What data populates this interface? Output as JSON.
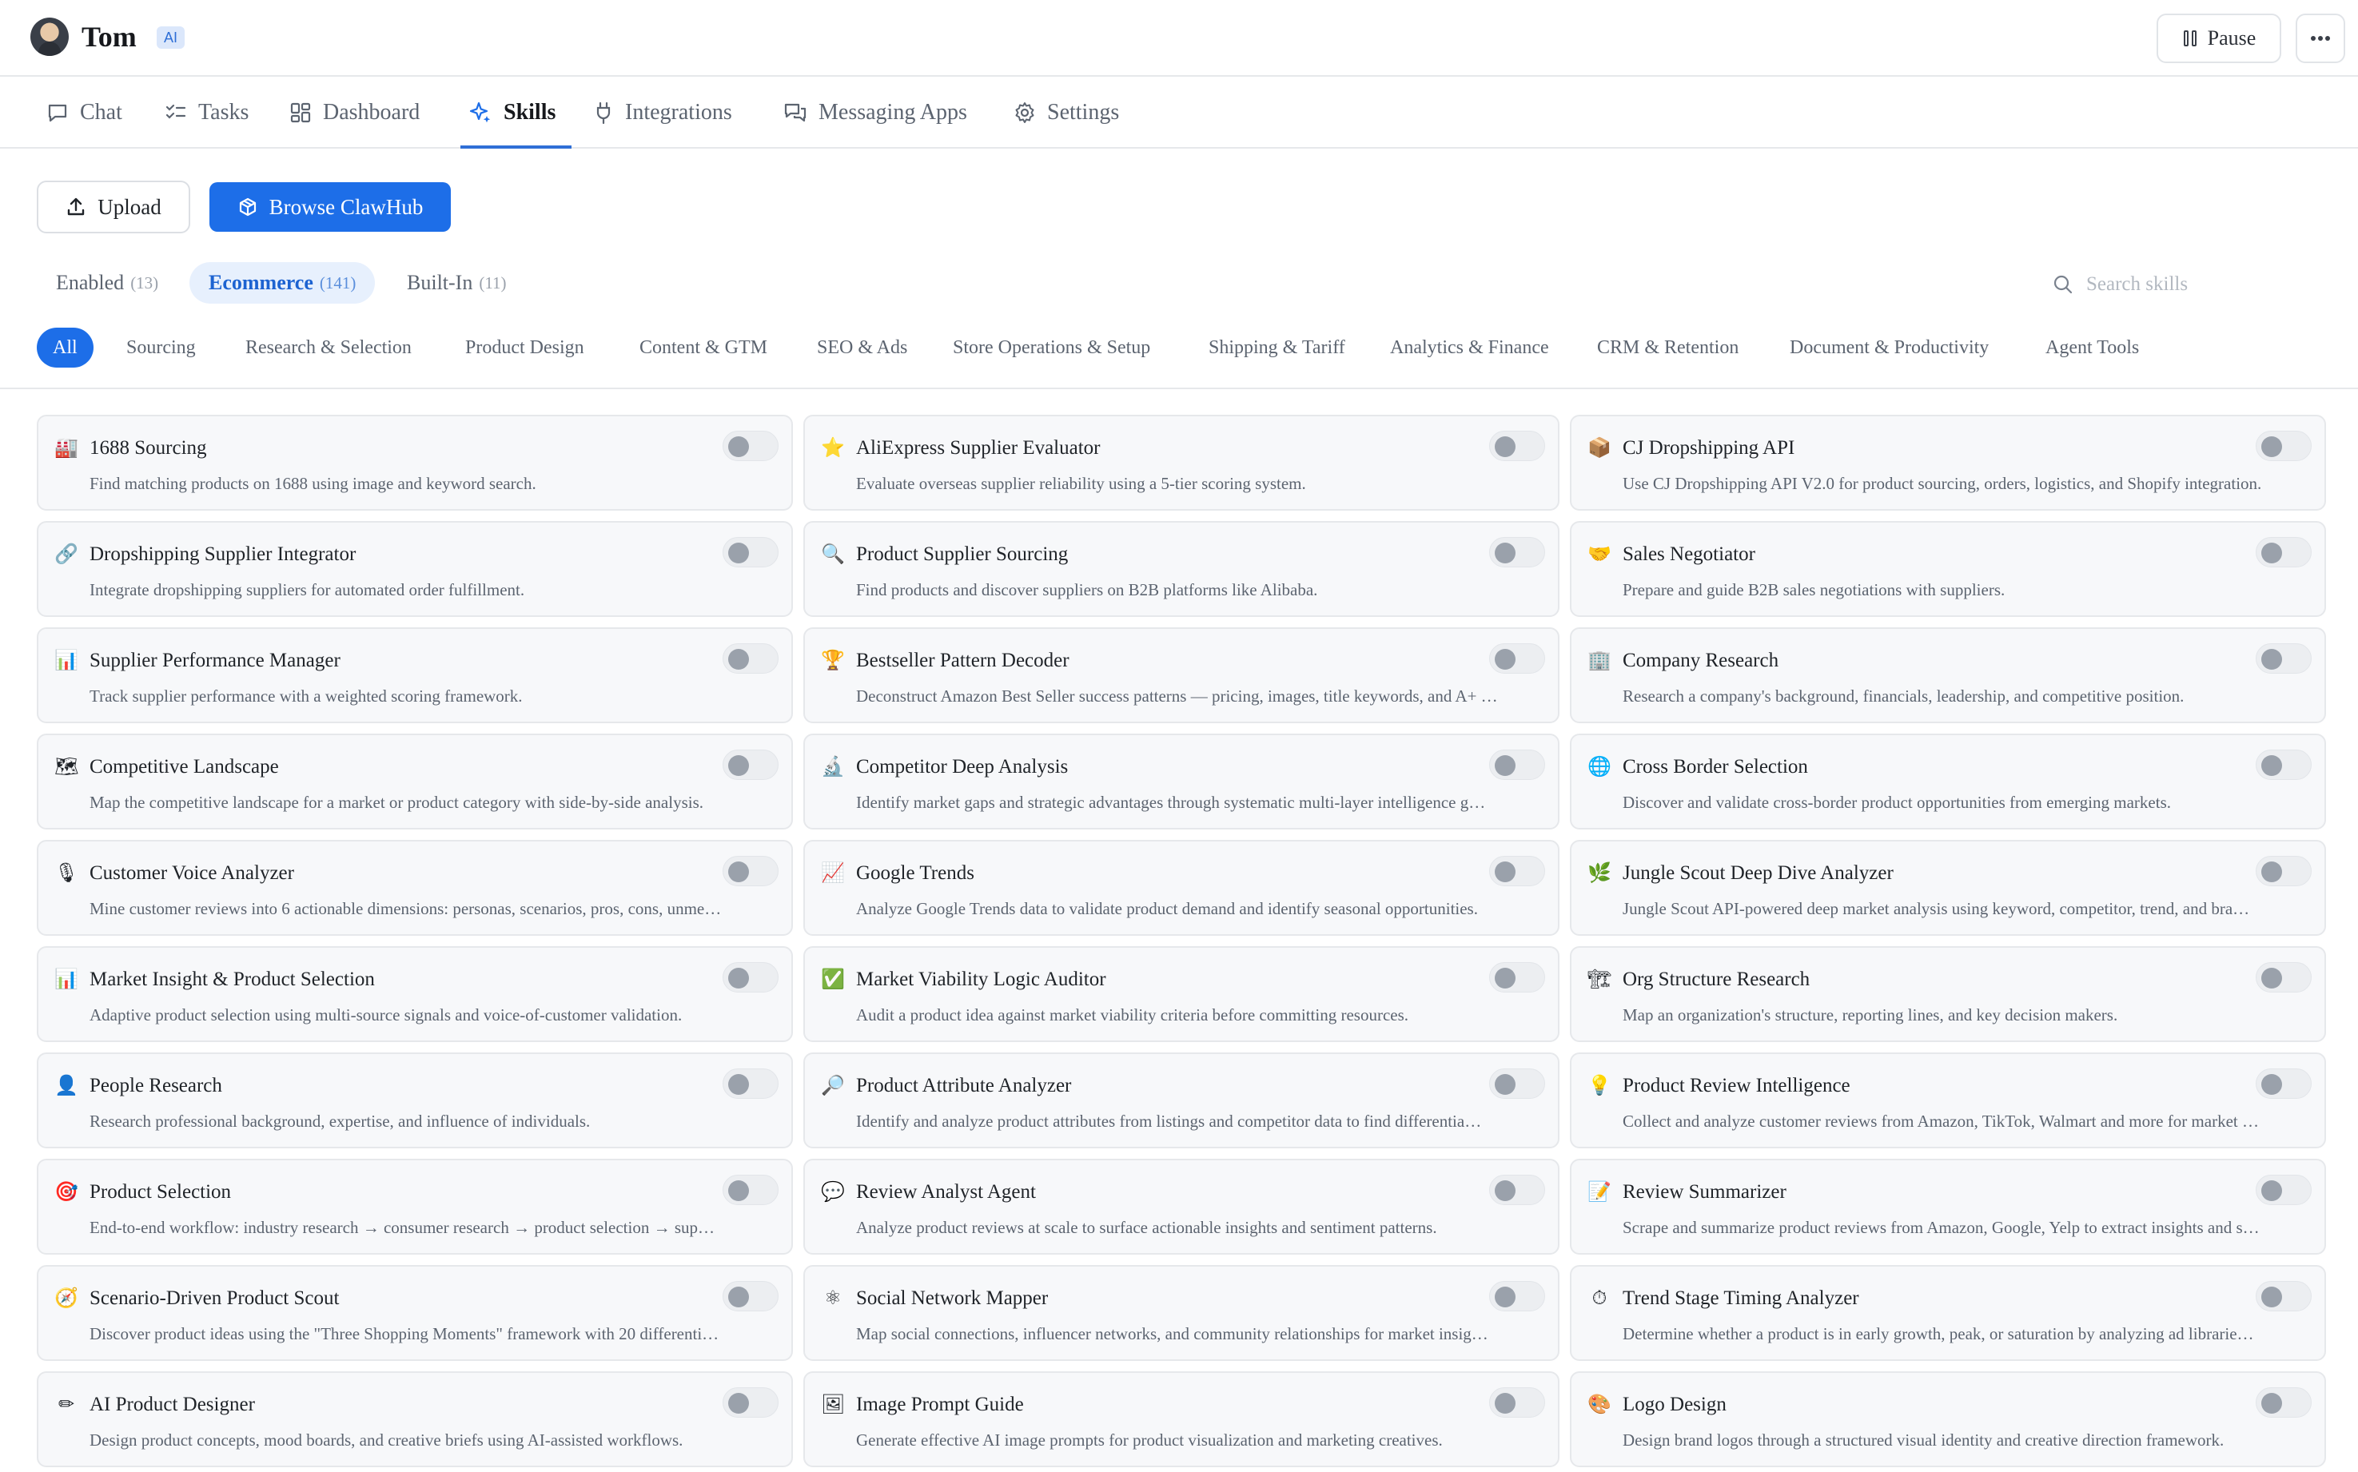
{
  "header": {
    "agent_name": "Tom",
    "ai_badge": "AI",
    "pause_label": "Pause",
    "more_icon": "more-horizontal-icon"
  },
  "nav": {
    "tabs": [
      {
        "label": "Chat",
        "icon": "chat-icon"
      },
      {
        "label": "Tasks",
        "icon": "tasks-icon"
      },
      {
        "label": "Dashboard",
        "icon": "dashboard-icon"
      },
      {
        "label": "Skills",
        "icon": "sparkles-icon",
        "active": true
      },
      {
        "label": "Integrations",
        "icon": "plug-icon"
      },
      {
        "label": "Messaging Apps",
        "icon": "messages-icon"
      },
      {
        "label": "Settings",
        "icon": "gear-icon"
      }
    ]
  },
  "actions": {
    "upload_label": "Upload",
    "browse_label": "Browse ClawHub"
  },
  "scopes": [
    {
      "label": "Enabled",
      "count": "(13)"
    },
    {
      "label": "Ecommerce",
      "count": "(141)",
      "active": true
    },
    {
      "label": "Built-In",
      "count": "(11)"
    }
  ],
  "search": {
    "placeholder": "Search skills",
    "value": ""
  },
  "categories": [
    "All",
    "Sourcing",
    "Research & Selection",
    "Product Design",
    "Content & GTM",
    "SEO & Ads",
    "Store Operations & Setup",
    "Shipping & Tariff",
    "Analytics & Finance",
    "CRM & Retention",
    "Document & Productivity",
    "Agent Tools"
  ],
  "active_category": "All",
  "colors": {
    "accent": "#1d6ee8",
    "card_bg": "#f7f8fa",
    "border": "#e6e8eb",
    "muted_text": "#5c6470"
  },
  "skills": [
    {
      "icon": "🏭",
      "icon_name": "factory-icon",
      "title": "1688 Sourcing",
      "desc": "Find matching products on 1688 using image and keyword search.",
      "enabled": false
    },
    {
      "icon": "⭐",
      "icon_name": "star-icon",
      "title": "AliExpress Supplier Evaluator",
      "desc": "Evaluate overseas supplier reliability using a 5-tier scoring system.",
      "enabled": false
    },
    {
      "icon": "📦",
      "icon_name": "package-icon",
      "title": "CJ Dropshipping API",
      "desc": "Use CJ Dropshipping API V2.0 for product sourcing, orders, logistics, and Shopify integration.",
      "enabled": false
    },
    {
      "icon": "🔗",
      "icon_name": "link-icon",
      "title": "Dropshipping Supplier Integrator",
      "desc": "Integrate dropshipping suppliers for automated order fulfillment.",
      "enabled": false
    },
    {
      "icon": "🔍",
      "icon_name": "magnifier-icon",
      "title": "Product Supplier Sourcing",
      "desc": "Find products and discover suppliers on B2B platforms like Alibaba.",
      "enabled": false
    },
    {
      "icon": "🤝",
      "icon_name": "handshake-icon",
      "title": "Sales Negotiator",
      "desc": "Prepare and guide B2B sales negotiations with suppliers.",
      "enabled": false
    },
    {
      "icon": "📊",
      "icon_name": "bar-chart-icon",
      "title": "Supplier Performance Manager",
      "desc": "Track supplier performance with a weighted scoring framework.",
      "enabled": false
    },
    {
      "icon": "🏆",
      "icon_name": "trophy-icon",
      "title": "Bestseller Pattern Decoder",
      "desc": "Deconstruct Amazon Best Seller success patterns — pricing, images, title keywords, and A+ …",
      "enabled": false
    },
    {
      "icon": "🏢",
      "icon_name": "office-building-icon",
      "title": "Company Research",
      "desc": "Research a company's background, financials, leadership, and competitive position.",
      "enabled": false
    },
    {
      "icon": "🗺",
      "icon_name": "map-icon",
      "title": "Competitive Landscape",
      "desc": "Map the competitive landscape for a market or product category with side-by-side analysis.",
      "enabled": false
    },
    {
      "icon": "🔬",
      "icon_name": "microscope-icon",
      "title": "Competitor Deep Analysis",
      "desc": "Identify market gaps and strategic advantages through systematic multi-layer intelligence g…",
      "enabled": false
    },
    {
      "icon": "🌐",
      "icon_name": "globe-icon",
      "title": "Cross Border Selection",
      "desc": "Discover and validate cross-border product opportunities from emerging markets.",
      "enabled": false
    },
    {
      "icon": "🎙",
      "icon_name": "microphone-icon",
      "title": "Customer Voice Analyzer",
      "desc": "Mine customer reviews into 6 actionable dimensions: personas, scenarios, pros, cons, unme…",
      "enabled": false
    },
    {
      "icon": "📈",
      "icon_name": "trending-chart-icon",
      "title": "Google Trends",
      "desc": "Analyze Google Trends data to validate product demand and identify seasonal opportunities.",
      "enabled": false
    },
    {
      "icon": "🌿",
      "icon_name": "herb-icon",
      "title": "Jungle Scout Deep Dive Analyzer",
      "desc": "Jungle Scout API-powered deep market analysis using keyword, competitor, trend, and bra…",
      "enabled": false
    },
    {
      "icon": "📊",
      "icon_name": "bar-chart-icon",
      "title": "Market Insight & Product Selection",
      "desc": "Adaptive product selection using multi-source signals and voice-of-customer validation.",
      "enabled": false
    },
    {
      "icon": "✅",
      "icon_name": "check-box-icon",
      "title": "Market Viability Logic Auditor",
      "desc": "Audit a product idea against market viability criteria before committing resources.",
      "enabled": false
    },
    {
      "icon": "🏗",
      "icon_name": "construction-icon",
      "title": "Org Structure Research",
      "desc": "Map an organization's structure, reporting lines, and key decision makers.",
      "enabled": false
    },
    {
      "icon": "👤",
      "icon_name": "person-icon",
      "title": "People Research",
      "desc": "Research professional background, expertise, and influence of individuals.",
      "enabled": false
    },
    {
      "icon": "🔎",
      "icon_name": "magnifier-right-icon",
      "title": "Product Attribute Analyzer",
      "desc": "Identify and analyze product attributes from listings and competitor data to find differentia…",
      "enabled": false
    },
    {
      "icon": "💡",
      "icon_name": "light-bulb-icon",
      "title": "Product Review Intelligence",
      "desc": "Collect and analyze customer reviews from Amazon, TikTok, Walmart and more for market …",
      "enabled": false
    },
    {
      "icon": "🎯",
      "icon_name": "target-icon",
      "title": "Product Selection",
      "desc": "End-to-end workflow: industry research → consumer research → product selection → sup…",
      "enabled": false
    },
    {
      "icon": "💬",
      "icon_name": "speech-bubble-icon",
      "title": "Review Analyst Agent",
      "desc": "Analyze product reviews at scale to surface actionable insights and sentiment patterns.",
      "enabled": false
    },
    {
      "icon": "📝",
      "icon_name": "memo-icon",
      "title": "Review Summarizer",
      "desc": "Scrape and summarize product reviews from Amazon, Google, Yelp to extract insights and s…",
      "enabled": false
    },
    {
      "icon": "🧭",
      "icon_name": "compass-icon",
      "title": "Scenario-Driven Product Scout",
      "desc": "Discover product ideas using the \"Three Shopping Moments\" framework with 20 differenti…",
      "enabled": false
    },
    {
      "icon": "⚛",
      "icon_name": "atom-icon",
      "title": "Social Network Mapper",
      "desc": "Map social connections, influencer networks, and community relationships for market insig…",
      "enabled": false
    },
    {
      "icon": "⏱",
      "icon_name": "stopwatch-icon",
      "title": "Trend Stage Timing Analyzer",
      "desc": "Determine whether a product is in early growth, peak, or saturation by analyzing ad librarie…",
      "enabled": false
    },
    {
      "icon": "✏",
      "icon_name": "pencil-icon",
      "title": "AI Product Designer",
      "desc": "Design product concepts, mood boards, and creative briefs using AI-assisted workflows.",
      "enabled": false
    },
    {
      "icon": "🖼",
      "icon_name": "framed-picture-icon",
      "title": "Image Prompt Guide",
      "desc": "Generate effective AI image prompts for product visualization and marketing creatives.",
      "enabled": false
    },
    {
      "icon": "🎨",
      "icon_name": "palette-icon",
      "title": "Logo Design",
      "desc": "Design brand logos through a structured visual identity and creative direction framework.",
      "enabled": false
    }
  ]
}
